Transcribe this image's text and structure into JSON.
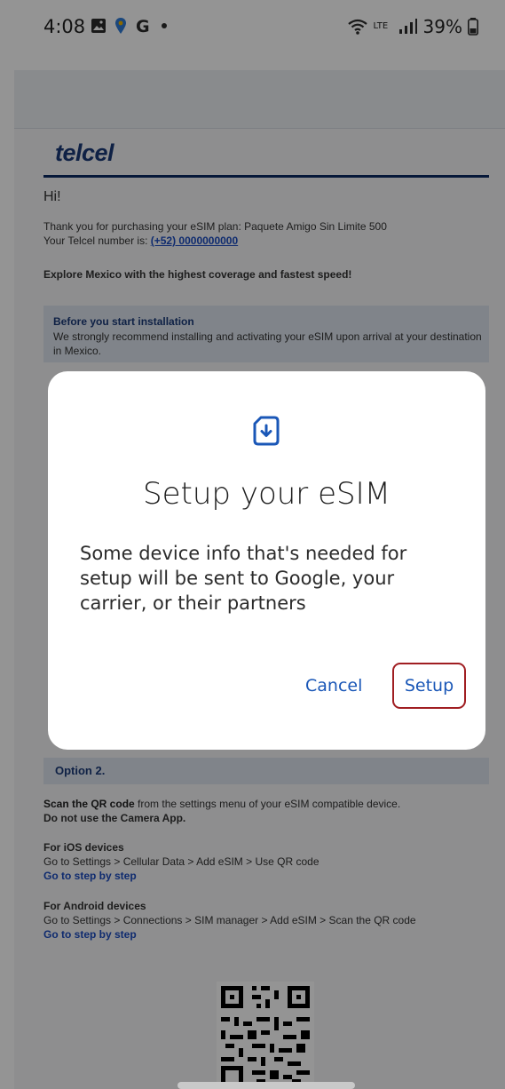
{
  "status_bar": {
    "time": "4:08",
    "notification_icons": [
      "gallery-icon",
      "location-pin-icon",
      "google-g-icon",
      "dot-icon"
    ],
    "network_label": "LTE",
    "battery": "39%"
  },
  "email": {
    "logo": "telcel",
    "greeting": "Hi!",
    "purchase_text": "Thank you for purchasing your eSIM plan: Paquete Amigo Sin Limite 500",
    "number_prefix": "Your Telcel number is: ",
    "number": "(+52) 0000000000",
    "explore": "Explore Mexico with the highest coverage and fastest speed!",
    "info_title": "Before you start installation",
    "info_body": "We strongly recommend installing and activating your eSIM upon arrival at your destination in Mexico.",
    "option2": "Option 2.",
    "scan_bold": "Scan the QR code",
    "scan_rest": " from the settings menu of your eSIM compatible device.",
    "do_not": "Do not use the Camera App.",
    "ios_heading": "For iOS devices",
    "ios_path": "Go to Settings > Cellular Data > Add eSIM > Use QR code",
    "ios_link": "Go to step by step",
    "android_heading": "For Android devices",
    "android_path": "Go to Settings > Connections > SIM manager > Add eSIM > Scan the QR code",
    "android_link": "Go to step by step"
  },
  "dialog": {
    "icon": "sim-download-icon",
    "title": "Setup your eSIM",
    "body": "Some device info that's needed for setup will be sent to Google, your carrier, or their partners",
    "cancel_label": "Cancel",
    "setup_label": "Setup"
  },
  "colors": {
    "brand": "#1a3a78",
    "link": "#1a4bbf",
    "dialog_button": "#1a57b7",
    "highlight_border": "#a01e22"
  }
}
